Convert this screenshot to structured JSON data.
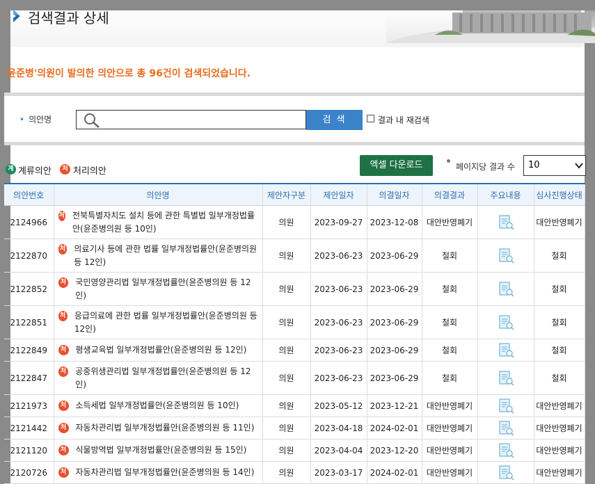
{
  "page": {
    "title": "검색결과 상세"
  },
  "result": {
    "prefix": "'윤준병'의원이 발의한 의안으로 총 ",
    "count": "96",
    "suffix": "건이 검색되었습니다."
  },
  "search": {
    "label": "의안명",
    "value": "",
    "button": "검 색",
    "recheck_label": "결과 내 재검색"
  },
  "legend": {
    "pending": "계류의안",
    "processed": "처리의안",
    "pending_icon": "계",
    "processed_icon": "처"
  },
  "toolbar": {
    "excel_button": "엑셀 다운로드",
    "per_page_label": "페이지당 결과 수",
    "per_page_value": "10"
  },
  "table": {
    "headers": [
      "의안번호",
      "의안명",
      "제안자구분",
      "제안일자",
      "의결일자",
      "의결결과",
      "주요내용",
      "심사진행상태"
    ],
    "rows": [
      {
        "no": "2124966",
        "name": "전북특별자치도 설치 등에 관한 특별법 일부개정법률안(윤준병의원 등 10인)",
        "proposer": "의원",
        "proposed": "2023-09-27",
        "decided": "2023-12-08",
        "result": "대안반영폐기",
        "status": "대안반영폐기"
      },
      {
        "no": "2122870",
        "name": "의료기사 등에 관한 법률 일부개정법률안(윤준병의원 등 12인)",
        "proposer": "의원",
        "proposed": "2023-06-23",
        "decided": "2023-06-29",
        "result": "철회",
        "status": "철회"
      },
      {
        "no": "2122852",
        "name": "국민영양관리법 일부개정법률안(윤준병의원 등 12인)",
        "proposer": "의원",
        "proposed": "2023-06-23",
        "decided": "2023-06-29",
        "result": "철회",
        "status": "철회"
      },
      {
        "no": "2122851",
        "name": "응급의료에 관한 법률 일부개정법률안(윤준병의원 등 12인)",
        "proposer": "의원",
        "proposed": "2023-06-23",
        "decided": "2023-06-29",
        "result": "철회",
        "status": "철회"
      },
      {
        "no": "2122849",
        "name": "평생교육법 일부개정법률안(윤준병의원 등 12인)",
        "proposer": "의원",
        "proposed": "2023-06-23",
        "decided": "2023-06-29",
        "result": "철회",
        "status": "철회"
      },
      {
        "no": "2122847",
        "name": "공중위생관리법 일부개정법률안(윤준병의원 등 12인)",
        "proposer": "의원",
        "proposed": "2023-06-23",
        "decided": "2023-06-29",
        "result": "철회",
        "status": "철회"
      },
      {
        "no": "2121973",
        "name": "소득세법 일부개정법률안(윤준병의원 등 10인)",
        "proposer": "의원",
        "proposed": "2023-05-12",
        "decided": "2023-12-21",
        "result": "대안반영폐기",
        "status": "대안반영폐기"
      },
      {
        "no": "2121442",
        "name": "자동차관리법 일부개정법률안(윤준병의원 등 11인)",
        "proposer": "의원",
        "proposed": "2023-04-18",
        "decided": "2024-02-01",
        "result": "대안반영폐기",
        "status": "대안반영폐기"
      },
      {
        "no": "2121120",
        "name": "식물방역법 일부개정법률안(윤준병의원 등 15인)",
        "proposer": "의원",
        "proposed": "2023-04-04",
        "decided": "2023-12-20",
        "result": "대안반영폐기",
        "status": "대안반영폐기"
      },
      {
        "no": "2120726",
        "name": "자동차관리법 일부개정법률안(윤준병의원 등 14인)",
        "proposer": "의원",
        "proposed": "2023-03-17",
        "decided": "2024-02-01",
        "result": "대안반영폐기",
        "status": "대안반영폐기"
      }
    ]
  }
}
